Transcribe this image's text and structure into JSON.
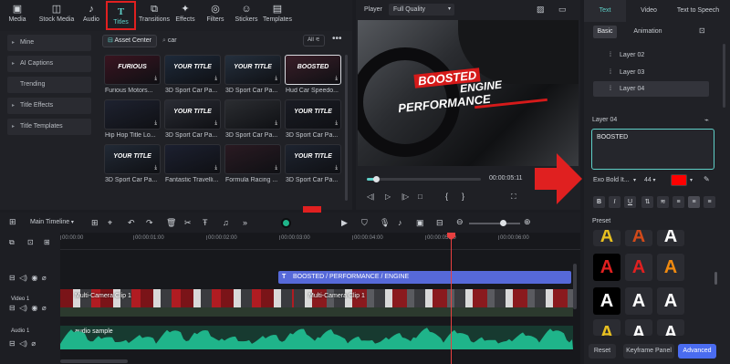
{
  "toolbar": {
    "tabs": [
      {
        "label": "Media",
        "icon": "media-icon"
      },
      {
        "label": "Stock Media",
        "icon": "stock-media-icon"
      },
      {
        "label": "Audio",
        "icon": "audio-icon"
      },
      {
        "label": "Titles",
        "icon": "titles-icon"
      },
      {
        "label": "Transitions",
        "icon": "transitions-icon"
      },
      {
        "label": "Effects",
        "icon": "effects-icon"
      },
      {
        "label": "Filters",
        "icon": "filters-icon"
      },
      {
        "label": "Stickers",
        "icon": "stickers-icon"
      },
      {
        "label": "Templates",
        "icon": "templates-icon"
      }
    ],
    "active_tab": "Titles"
  },
  "sidebar": {
    "items": [
      "Mine",
      "AI Captions",
      "Trending",
      "Title Effects",
      "Title Templates"
    ]
  },
  "library": {
    "asset_center": "Asset Center",
    "search_value": "car",
    "filter": "All",
    "items": [
      "Furious Motors...",
      "3D Sport Car Pa...",
      "3D Sport Car Pa...",
      "Hud Car Speedo...",
      "Hip Hop Title Lo...",
      "3D Sport Car Pa...",
      "3D Sport Car Pa...",
      "3D Sport Car Pa...",
      "3D Sport Car Pa...",
      "Fantastic Travelli...",
      "Formula Racing ...",
      "3D Sport Car Pa..."
    ],
    "thumb_texts": [
      "FURIOUS",
      "YOUR TITLE",
      "YOUR TITLE",
      "BOOSTED",
      "",
      "YOUR TITLE",
      "",
      "YOUR TITLE",
      "YOUR TITLE",
      "",
      "",
      "YOUR TITLE"
    ]
  },
  "player": {
    "label": "Player",
    "quality": "Full Quality",
    "time": "00:00:05:11",
    "title_line1": "BOOSTED",
    "title_line2": "ENGINE",
    "title_line3": "PERFORMANCE",
    "total_partial": "17",
    "progress": 0.08
  },
  "right_panel": {
    "tabs": [
      "Text",
      "Video",
      "Text to Speech"
    ],
    "subtabs": [
      "Basic",
      "Animation"
    ],
    "layers": [
      "Layer 02",
      "Layer 03",
      "Layer 04"
    ],
    "selected_layer": "Layer 04",
    "layer_heading": "Layer 04",
    "text_value": "BOOSTED",
    "font": "Exo Bold It...",
    "size": "44",
    "color": "#ff0000",
    "format_buttons": [
      "B",
      "I",
      "U"
    ],
    "preset_label": "Preset",
    "buttons": {
      "reset": "Reset",
      "keyframe": "Keyframe Panel",
      "advanced": "Advanced"
    }
  },
  "timeline": {
    "label": "Main Timeline",
    "ruler": [
      "00:00:00",
      "00:00:01:00",
      "00:00:02:00",
      "00:00:03:00",
      "00:00:04:00",
      "00:00:05:00",
      "00:00:06:00"
    ],
    "title_clip": "BOOSTED / PERFORMANCE / ENGINE",
    "video_clip_a": "Multi-Camera Clip 1",
    "video_clip_b": "Multi-Camera Clip 1",
    "audio_clip": "audio sample",
    "track_video": "Video 1",
    "track_audio": "Audio 1"
  },
  "colors": {
    "accent": "#5fd0c8",
    "highlight_red": "#e02020",
    "title_clip": "#5669d9",
    "audio_wave": "#1fb48a",
    "advanced_button": "#4a6cf0"
  }
}
